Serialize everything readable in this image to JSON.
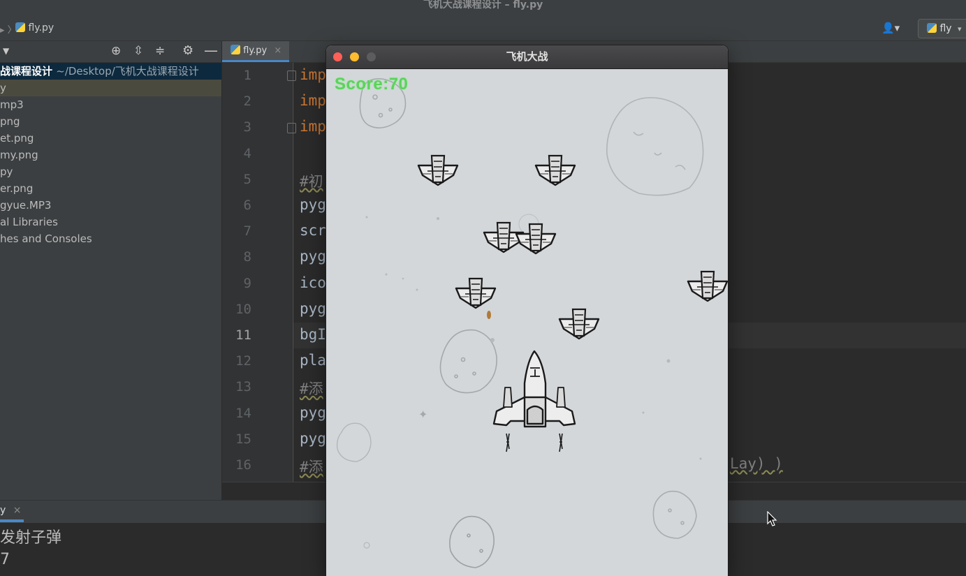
{
  "ide": {
    "window_title": "飞机大战课程设计 – fly.py",
    "breadcrumb_file": "fly.py",
    "run_config": "fly",
    "project_tree": [
      {
        "label": "战课程设计",
        "path": "~/Desktop/飞机大战课程设计",
        "root": true
      },
      {
        "label": "y",
        "selected": true
      },
      {
        "label": "mp3"
      },
      {
        "label": "png"
      },
      {
        "label": "et.png"
      },
      {
        "label": "my.png"
      },
      {
        "label": "py"
      },
      {
        "label": "er.png"
      },
      {
        "label": "gyue.MP3"
      },
      {
        "label": "al Libraries"
      },
      {
        "label": "hes and Consoles"
      }
    ],
    "editor_tab": "fly.py",
    "current_line": 11,
    "line_numbers": [
      "1",
      "2",
      "3",
      "4",
      "5",
      "6",
      "7",
      "8",
      "9",
      "10",
      "11",
      "12",
      "13",
      "14",
      "15",
      "16"
    ],
    "code_lines": [
      {
        "text": "imp",
        "kind": "kw"
      },
      {
        "text": "imp",
        "kind": "kw"
      },
      {
        "text": "imp",
        "kind": "kw"
      },
      {
        "text": "",
        "kind": "plain"
      },
      {
        "text": "#初",
        "kind": "cm"
      },
      {
        "text": "pyg",
        "kind": "plain"
      },
      {
        "text": "scr",
        "kind": "plain"
      },
      {
        "text": "pyg",
        "kind": "plain"
      },
      {
        "text": "ico",
        "kind": "plain"
      },
      {
        "text": "pyg",
        "kind": "plain"
      },
      {
        "text": "bgI",
        "kind": "plain"
      },
      {
        "text": "pla",
        "kind": "plain"
      },
      {
        "text": "#添",
        "kind": "cm"
      },
      {
        "text": "pyg",
        "kind": "plain"
      },
      {
        "text": "pyg",
        "kind": "plain"
      },
      {
        "text": "#添",
        "kind": "cm"
      }
    ],
    "code_tail_line16": "Lay) )",
    "run_tab": "y",
    "console_lines": [
      "发射子弹",
      "7"
    ]
  },
  "game": {
    "title": "飞机大战",
    "score_text": "Score:70",
    "score_color": "#5bd35b",
    "traffic_lights": {
      "close": "#fe5f57",
      "minimize": "#febc2e",
      "zoom": "#5c5c5e"
    }
  }
}
